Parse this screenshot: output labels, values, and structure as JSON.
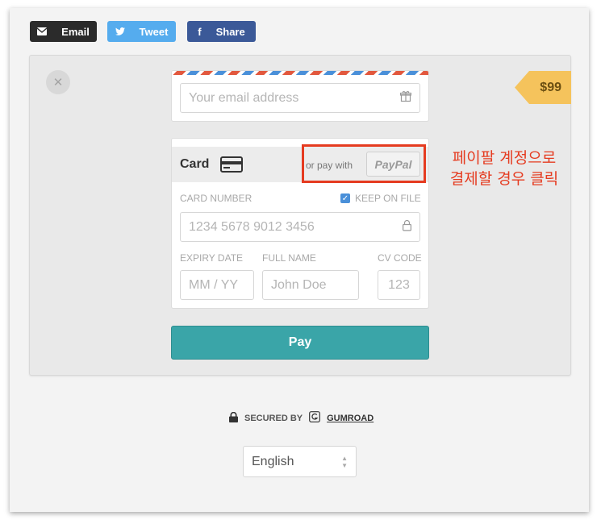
{
  "share": {
    "email_label": "Email",
    "tweet_label": "Tweet",
    "share_label": "Share"
  },
  "product": {
    "price": "$99"
  },
  "email_form": {
    "placeholder": "Your email address"
  },
  "card_form": {
    "title": "Card",
    "or_pay_with": "or pay with",
    "paypal_label": "PayPal",
    "card_number_label": "CARD NUMBER",
    "keep_on_file_label": "KEEP ON FILE",
    "keep_on_file_checked": true,
    "card_number_placeholder": "1234 5678 9012 3456",
    "expiry_label": "EXPIRY DATE",
    "full_name_label": "FULL NAME",
    "cv_code_label": "CV CODE",
    "expiry_placeholder": "MM / YY",
    "name_placeholder": "John Doe",
    "cvc_placeholder": "123"
  },
  "annotation": {
    "line1": "페이팔 계정으로",
    "line2": "결제할 경우 클릭"
  },
  "pay_button_label": "Pay",
  "footer": {
    "secured_by": "SECURED BY",
    "gumroad": "GUMROAD",
    "language": "English"
  },
  "colors": {
    "pay_button": "#3aa5a8",
    "price_tag": "#f5c35c",
    "annotation": "#e53b20",
    "twitter": "#55acee",
    "facebook": "#3b5998"
  }
}
